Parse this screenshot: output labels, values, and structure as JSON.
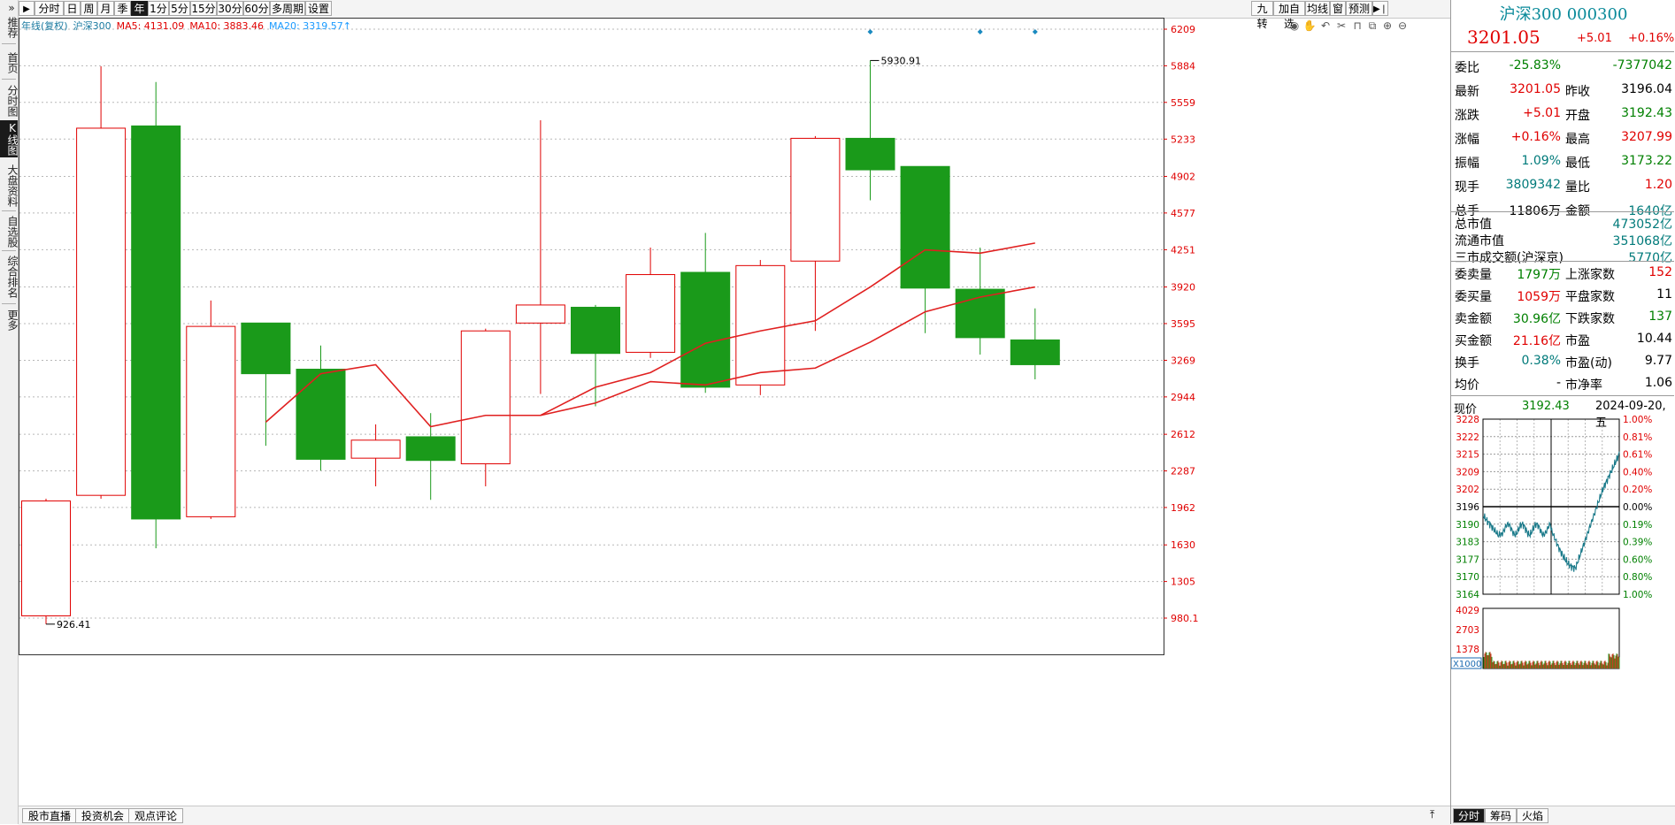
{
  "sidebar": {
    "items": [
      {
        "label": "推荐"
      },
      {
        "label": "首页"
      },
      {
        "label": "分时图"
      },
      {
        "label": "K线图"
      },
      {
        "label": "大盘资料"
      },
      {
        "label": "自选股"
      },
      {
        "label": "综合排名"
      },
      {
        "label": "更多"
      }
    ],
    "active_index": 3
  },
  "toolbar": {
    "nav_glyph": "▶",
    "periods": [
      "分时",
      "日",
      "周",
      "月",
      "季",
      "年",
      "1分",
      "5分",
      "15分",
      "30分",
      "60分",
      "多周期",
      "设置"
    ],
    "active_period": "年",
    "right_tools": [
      "九转",
      "加自选",
      "均线",
      "窗",
      "预测"
    ]
  },
  "legend": {
    "series": "年线(复权)",
    "index": "沪深300",
    "ma5": "MA5: 4131.09",
    "ma10": "MA10: 3883.46",
    "ma20": "MA20: 3319.57↑"
  },
  "chart_icons": [
    "eye-icon",
    "hand-icon",
    "undo-icon",
    "scissor-icon",
    "lock-icon",
    "copy-icon",
    "zoom-in-icon",
    "zoom-out-icon"
  ],
  "chart_data": {
    "type": "candlestick",
    "y_ticks": [
      980.1,
      1305,
      1630,
      1962,
      2287,
      2612,
      2944,
      3269,
      3595,
      3920,
      4251,
      4577,
      4902,
      5233,
      5559,
      5884,
      6209
    ],
    "y_tick_labels": [
      "980.1",
      "1305",
      "1630",
      "1962",
      "2287",
      "2612",
      "2944",
      "3269",
      "3595",
      "3920",
      "4251",
      "4577",
      "4902",
      "5233",
      "5559",
      "5884",
      "6209"
    ],
    "candles": [
      {
        "open": 1000,
        "close": 2020,
        "high": 2040,
        "low": 926.41
      },
      {
        "open": 2070,
        "close": 5330,
        "high": 5880,
        "low": 2040
      },
      {
        "open": 5350,
        "close": 1860,
        "high": 5740,
        "low": 1600
      },
      {
        "open": 1880,
        "close": 3570,
        "high": 3800,
        "low": 1860
      },
      {
        "open": 3600,
        "close": 3150,
        "high": 3600,
        "low": 2510
      },
      {
        "open": 3190,
        "close": 2390,
        "high": 3400,
        "low": 2290
      },
      {
        "open": 2400,
        "close": 2560,
        "high": 2700,
        "low": 2150
      },
      {
        "open": 2590,
        "close": 2380,
        "high": 2800,
        "low": 2030
      },
      {
        "open": 2350,
        "close": 3530,
        "high": 3550,
        "low": 2150
      },
      {
        "open": 3600,
        "close": 3760,
        "high": 5400,
        "low": 2970
      },
      {
        "open": 3740,
        "close": 3330,
        "high": 3760,
        "low": 2860
      },
      {
        "open": 3340,
        "close": 4030,
        "high": 4270,
        "low": 3290
      },
      {
        "open": 4050,
        "close": 3030,
        "high": 4400,
        "low": 2980
      },
      {
        "open": 3050,
        "close": 4110,
        "high": 4160,
        "low": 2960
      },
      {
        "open": 4150,
        "close": 5240,
        "high": 5260,
        "low": 3530
      },
      {
        "open": 5240,
        "close": 4960,
        "high": 5930.91,
        "low": 4690
      },
      {
        "open": 4990,
        "close": 3910,
        "high": 4990,
        "low": 3510
      },
      {
        "open": 3900,
        "close": 3470,
        "high": 4270,
        "low": 3320
      },
      {
        "open": 3450,
        "close": 3230,
        "high": 3730,
        "low": 3100
      }
    ],
    "ma_lines": [
      {
        "name": "MA5",
        "color": "#e02020",
        "values": [
          null,
          null,
          null,
          null,
          2720,
          3150,
          3230,
          2680,
          2780,
          2780,
          3030,
          3160,
          3420,
          3530,
          3620,
          3920,
          4250,
          4220,
          4310,
          4130
        ]
      },
      {
        "name": "MA10",
        "color": "#e02020",
        "values": [
          null,
          null,
          null,
          null,
          null,
          null,
          null,
          null,
          null,
          2780,
          2890,
          3080,
          3050,
          3160,
          3200,
          3430,
          3700,
          3830,
          3920,
          3880
        ]
      }
    ],
    "markers": [
      {
        "label": "5930.91",
        "candle_index": 15,
        "type": "high"
      },
      {
        "label": "926.41",
        "candle_index": 0,
        "type": "low"
      }
    ],
    "diamond_markers": [
      15,
      17,
      18
    ],
    "ylim": [
      800,
      6300
    ],
    "grid": true,
    "up_color": "#e00000",
    "down_color": "#1a9a1a"
  },
  "quote": {
    "name": "沪深300",
    "code": "000300",
    "price": "3201.05",
    "change": "+5.01",
    "change_pct": "+0.16%",
    "rows": [
      {
        "l1": "委比",
        "v1": "-25.83%",
        "c1": "green",
        "l2": "",
        "v2": "-7377042",
        "c2": "green"
      },
      {
        "l1": "最新",
        "v1": "3201.05",
        "c1": "red",
        "l2": "昨收",
        "v2": "3196.04",
        "c2": "blk"
      },
      {
        "l1": "涨跌",
        "v1": "+5.01",
        "c1": "red",
        "l2": "开盘",
        "v2": "3192.43",
        "c2": "green"
      },
      {
        "l1": "涨幅",
        "v1": "+0.16%",
        "c1": "red",
        "l2": "最高",
        "v2": "3207.99",
        "c2": "red"
      },
      {
        "l1": "振幅",
        "v1": "1.09%",
        "c1": "teal",
        "l2": "最低",
        "v2": "3173.22",
        "c2": "green"
      },
      {
        "l1": "现手",
        "v1": "3809342",
        "c1": "teal",
        "l2": "量比",
        "v2": "1.20",
        "c2": "red"
      },
      {
        "l1": "总手",
        "v1": "11806万",
        "c1": "blk",
        "l2": "金额",
        "v2": "1640亿",
        "c2": "teal"
      }
    ],
    "market": [
      {
        "label": "总市值",
        "value": "473052亿"
      },
      {
        "label": "流通市值",
        "value": "351068亿"
      },
      {
        "label": "三市成交额(沪深京)",
        "value": "5770亿"
      }
    ],
    "stats": [
      {
        "l1": "委卖量",
        "v1": "1797万",
        "c1": "green",
        "l2": "上涨家数",
        "v2": "152",
        "c2": "red"
      },
      {
        "l1": "委买量",
        "v1": "1059万",
        "c1": "red",
        "l2": "平盘家数",
        "v2": "11",
        "c2": "blk"
      },
      {
        "l1": "卖金额",
        "v1": "30.96亿",
        "c1": "green",
        "l2": "下跌家数",
        "v2": "137",
        "c2": "green"
      },
      {
        "l1": "买金额",
        "v1": "21.16亿",
        "c1": "red",
        "l2": "市盈",
        "v2": "10.44",
        "c2": "blk"
      },
      {
        "l1": "换手",
        "v1": "0.38%",
        "c1": "teal",
        "l2": "市盈(动)",
        "v2": "9.77",
        "c2": "blk"
      },
      {
        "l1": "均价",
        "v1": "-",
        "c1": "blk",
        "l2": "市净率",
        "v2": "1.06",
        "c2": "blk"
      }
    ],
    "mini": {
      "label": "现价",
      "price": "3192.43",
      "date": "2024-09-20,五",
      "left_ticks": [
        "3228",
        "3222",
        "3215",
        "3209",
        "3202",
        "3196",
        "3190",
        "3183",
        "3177",
        "3170",
        "3164"
      ],
      "right_ticks": [
        "1.00%",
        "0.81%",
        "0.61%",
        "0.40%",
        "0.20%",
        "0.00%",
        "0.19%",
        "0.39%",
        "0.60%",
        "0.80%",
        "1.00%"
      ],
      "vol_ticks": [
        "4029",
        "2703",
        "1378"
      ],
      "vol_unit": "X1000",
      "tabs": [
        "分时",
        "筹码",
        "火焰"
      ]
    }
  },
  "bottom_tabs": [
    "股市直播",
    "投资机会",
    "观点评论"
  ],
  "bottom_icon": "pin-top-icon"
}
